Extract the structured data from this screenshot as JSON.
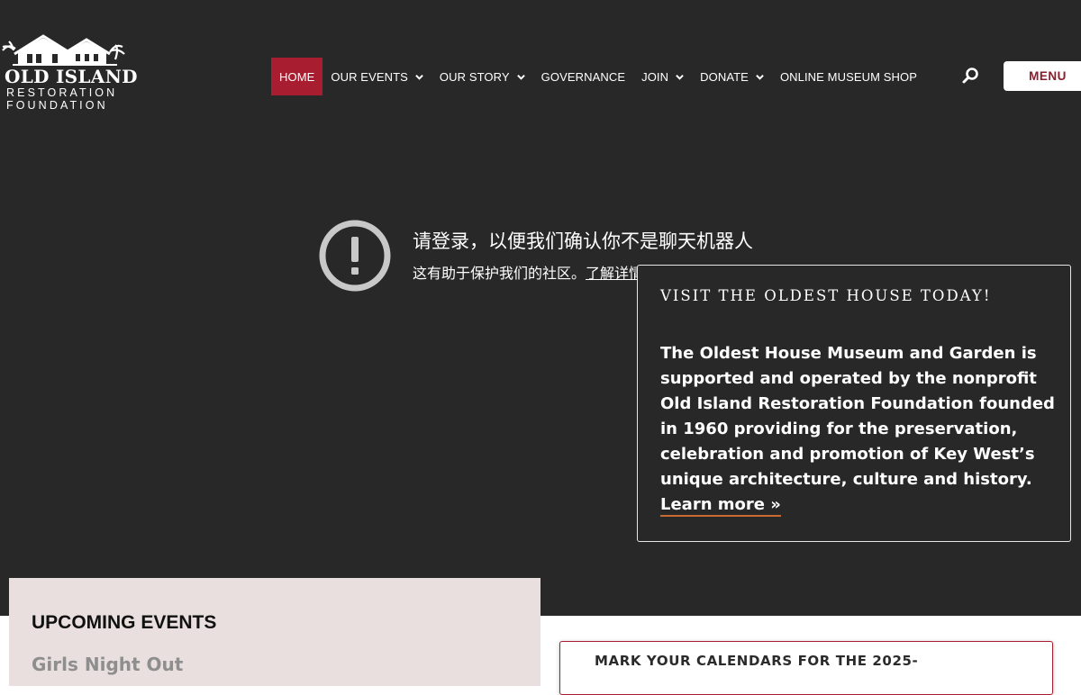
{
  "logo": {
    "line1": "OLD ISLAND",
    "line2": "RESTORATION",
    "line3": "FOUNDATION"
  },
  "nav": {
    "items": [
      {
        "label": "HOME",
        "active": true,
        "dropdown": false
      },
      {
        "label": "OUR EVENTS",
        "active": false,
        "dropdown": true
      },
      {
        "label": "OUR STORY",
        "active": false,
        "dropdown": true
      },
      {
        "label": "GOVERNANCE",
        "active": false,
        "dropdown": false
      },
      {
        "label": "JOIN",
        "active": false,
        "dropdown": true
      },
      {
        "label": "DONATE",
        "active": false,
        "dropdown": true
      },
      {
        "label": "ONLINE MUSEUM SHOP",
        "active": false,
        "dropdown": false
      }
    ],
    "search_icon": "search-icon",
    "menu_label": "MENU"
  },
  "error": {
    "icon": "exclamation-circle-icon",
    "title": "请登录，以便我们确认你不是聊天机器人",
    "subtitle": "这有助于保护我们的社区。",
    "link": "了解详情"
  },
  "visit": {
    "title": "VISIT THE OLDEST HOUSE TODAY!",
    "body": "The Oldest House Museum and Garden is supported and operated by the nonprofit Old Island Restoration Foundation founded in 1960 providing for the preservation, celebration and promotion of Key West’s unique architecture, culture and history.",
    "learn_more": "Learn more »"
  },
  "events": {
    "heading": "UPCOMING EVENTS",
    "first_event": "Girls Night Out"
  },
  "calendar_card": {
    "title": "MARK YOUR CALENDARS FOR THE 2025-"
  },
  "colors": {
    "dark_bg": "#282828",
    "accent_red": "#a91d30",
    "menu_text": "#8a1c2c",
    "events_panel": "#e8dfde",
    "link_underline": "#c96a2e"
  }
}
